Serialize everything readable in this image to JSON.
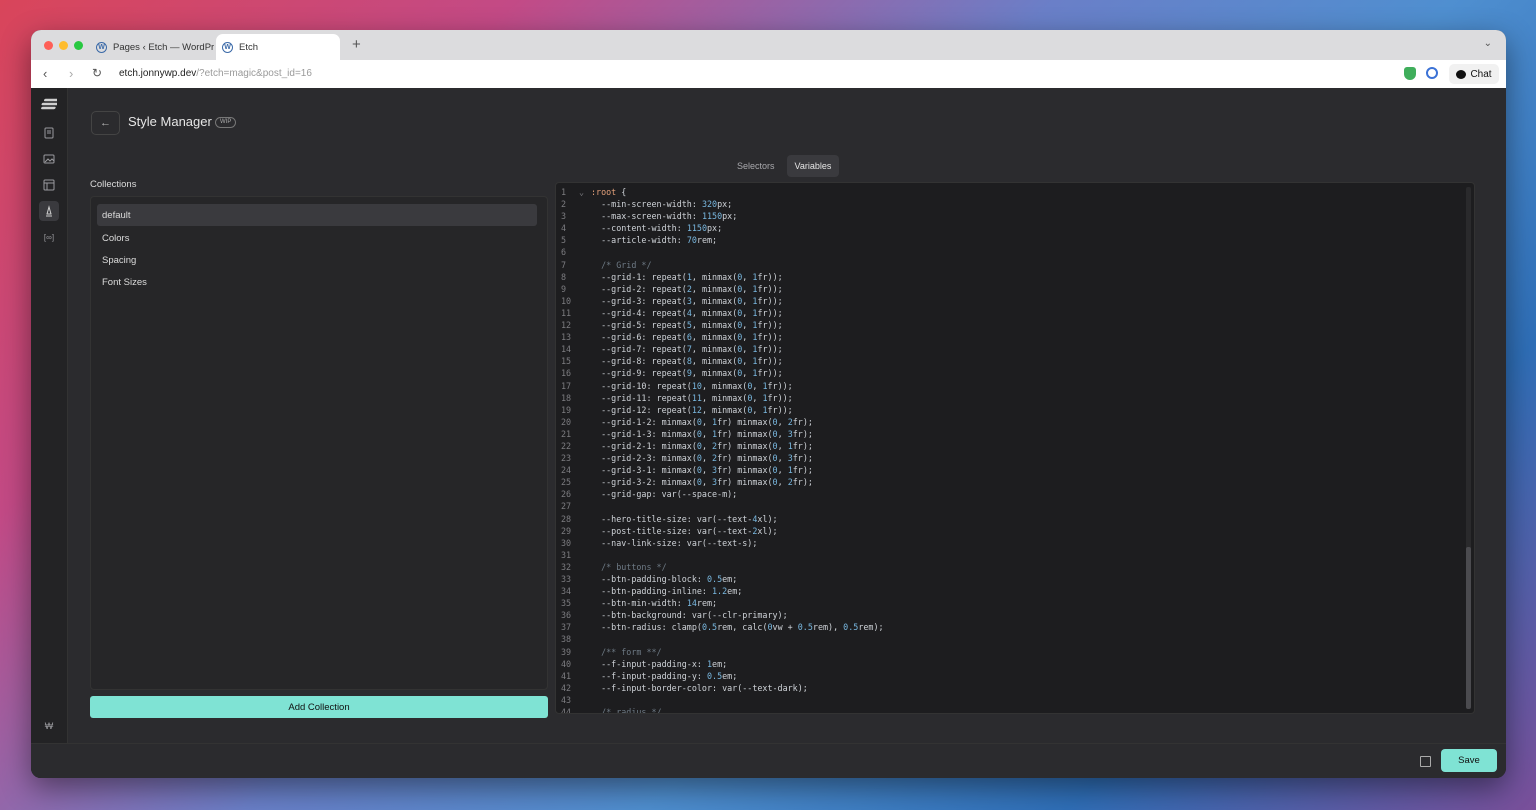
{
  "browser": {
    "tabs": [
      {
        "title": "Pages ‹ Etch — WordPr",
        "favicon": "wordpress-icon"
      },
      {
        "title": "Etch",
        "favicon": "wordpress-icon"
      }
    ],
    "new_tab": "+",
    "url_host": "etch.jonnywp.dev",
    "url_rest": "/?etch=magic&post_id=16",
    "chat_label": "Chat"
  },
  "header": {
    "back": "←",
    "title": "Style Manager",
    "badge": "WIP"
  },
  "tabs": [
    "Selectors",
    "Variables"
  ],
  "collections": {
    "label": "Collections",
    "items": [
      "default",
      "Colors",
      "Spacing",
      "Font Sizes"
    ],
    "add_label": "Add Collection"
  },
  "editor": {
    "lines": [
      ":root {",
      "  --min-screen-width: 320px;",
      "  --max-screen-width: 1150px;",
      "  --content-width: 1150px;",
      "  --article-width: 70rem;",
      "",
      "  /* Grid */",
      "  --grid-1: repeat(1, minmax(0, 1fr));",
      "  --grid-2: repeat(2, minmax(0, 1fr));",
      "  --grid-3: repeat(3, minmax(0, 1fr));",
      "  --grid-4: repeat(4, minmax(0, 1fr));",
      "  --grid-5: repeat(5, minmax(0, 1fr));",
      "  --grid-6: repeat(6, minmax(0, 1fr));",
      "  --grid-7: repeat(7, minmax(0, 1fr));",
      "  --grid-8: repeat(8, minmax(0, 1fr));",
      "  --grid-9: repeat(9, minmax(0, 1fr));",
      "  --grid-10: repeat(10, minmax(0, 1fr));",
      "  --grid-11: repeat(11, minmax(0, 1fr));",
      "  --grid-12: repeat(12, minmax(0, 1fr));",
      "  --grid-1-2: minmax(0, 1fr) minmax(0, 2fr);",
      "  --grid-1-3: minmax(0, 1fr) minmax(0, 3fr);",
      "  --grid-2-1: minmax(0, 2fr) minmax(0, 1fr);",
      "  --grid-2-3: minmax(0, 2fr) minmax(0, 3fr);",
      "  --grid-3-1: minmax(0, 3fr) minmax(0, 1fr);",
      "  --grid-3-2: minmax(0, 3fr) minmax(0, 2fr);",
      "  --grid-gap: var(--space-m);",
      "",
      "  --hero-title-size: var(--text-4xl);",
      "  --post-title-size: var(--text-2xl);",
      "  --nav-link-size: var(--text-s);",
      "",
      "  /* buttons */",
      "  --btn-padding-block: 0.5em;",
      "  --btn-padding-inline: 1.2em;",
      "  --btn-min-width: 14rem;",
      "  --btn-background: var(--clr-primary);",
      "  --btn-radius: clamp(0.5rem, calc(0vw + 0.5rem), 0.5rem);",
      "",
      "  /** form **/",
      "  --f-input-padding-x: 1em;",
      "  --f-input-padding-y: 0.5em;",
      "  --f-input-border-color: var(--text-dark);",
      "",
      "  /* radius */"
    ]
  },
  "footer": {
    "save_label": "Save"
  },
  "colors": {
    "accent": "#7fe3d4",
    "background": "#2b2b2e"
  }
}
